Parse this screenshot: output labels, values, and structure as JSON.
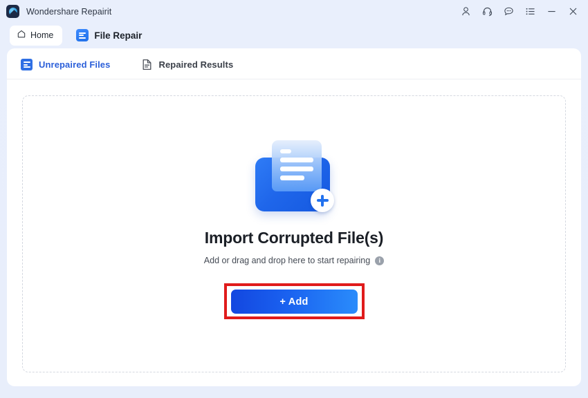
{
  "titlebar": {
    "app_title": "Wondershare Repairit",
    "logo_icon": "wondershare-logo-icon",
    "icons": [
      {
        "name": "account-icon",
        "glyph": "person"
      },
      {
        "name": "support-headset-icon",
        "glyph": "headset"
      },
      {
        "name": "feedback-chat-icon",
        "glyph": "chat-bubble"
      },
      {
        "name": "menu-list-icon",
        "glyph": "list"
      },
      {
        "name": "minimize-icon",
        "glyph": "minimize"
      },
      {
        "name": "close-icon",
        "glyph": "close"
      }
    ]
  },
  "nav": {
    "home_label": "Home",
    "home_icon": "house-icon",
    "file_repair_label": "File Repair",
    "file_repair_icon": "document-lines-icon"
  },
  "tabs": [
    {
      "label": "Unrepaired Files",
      "active": true,
      "icon": "blue-document-icon"
    },
    {
      "label": "Repaired Results",
      "active": false,
      "icon": "gray-file-icon"
    }
  ],
  "dropzone": {
    "illustration_icon": "import-file-illustration",
    "headline": "Import Corrupted File(s)",
    "subline": "Add or drag and drop here to start repairing",
    "info_icon_label": "i",
    "add_button_label": "+ Add"
  },
  "colors": {
    "page_background": "#e8eefb",
    "card_background": "#ffffff",
    "accent_blue": "#2b5fd9",
    "button_gradient_start": "#1347e0",
    "button_gradient_end": "#2a8cfb",
    "highlight_red": "#e01b1b",
    "dash_border": "#d4d8e0",
    "inactive_tab_text": "#3a3f48"
  }
}
